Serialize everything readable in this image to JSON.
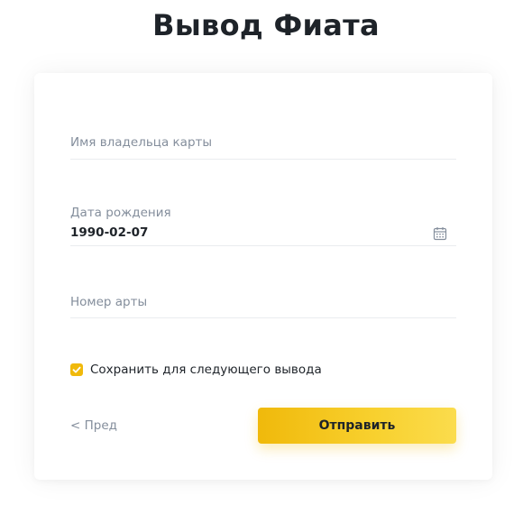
{
  "page": {
    "title": "Вывод Фиата"
  },
  "form": {
    "cardholder_name": {
      "label": "Имя владельца карты",
      "value": ""
    },
    "date_of_birth": {
      "label": "Дата рождения",
      "value": "1990-02-07",
      "icon": "calendar-icon"
    },
    "card_number": {
      "label": "Номер арты",
      "value": ""
    },
    "save_checkbox": {
      "label": "Сохранить для следующего вывода",
      "checked": true,
      "color": "#f0b90b"
    },
    "prev_label": "< Пред",
    "submit_label": "Отправить"
  },
  "colors": {
    "accent": "#f0b90b",
    "text_primary": "#1e2329",
    "text_secondary": "#848e9c",
    "divider": "#eaecef"
  }
}
